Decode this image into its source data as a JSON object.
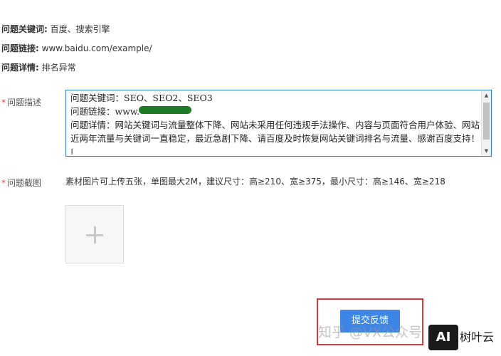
{
  "info": {
    "keywords_label": "问题关键词:",
    "keywords_value": "百度、搜索引擎",
    "link_label": "问题链接:",
    "link_value": "www.baidu.com/example/",
    "detail_label": "问题详情:",
    "detail_value": "排名异常"
  },
  "form": {
    "required_mark": "*",
    "description_label": "问题描述",
    "description_text": "问题关键词：SEO、SEO2、SEO3\n问题链接：www.\n问题详情：网站关键词与流量整体下降、网站未采用任何违规手法操作、内容与页面符合用户体验、网站近两年流量与关键词一直稳定，最近急剧下降、请百度及时恢复网站关键词排名与流量、感谢百度支持！|",
    "screenshot_label": "问题截图",
    "upload_hint": "素材图片可上传五张，单图最大2M，建议尺寸：高≥210、宽≥375，最小尺寸：高≥146、宽≥218",
    "submit_label": "提交反馈"
  },
  "watermark": {
    "text": "知乎 @VX公众号",
    "ai_badge": "AI",
    "brand": "树叶云"
  },
  "colors": {
    "accent": "#3d86e6",
    "highlight_border": "#d83a3a",
    "required": "#e44444",
    "redaction": "#1f7a26"
  },
  "icons": {
    "scroll_up": "triangle-up",
    "scroll_down": "triangle-down",
    "add": "plus"
  }
}
